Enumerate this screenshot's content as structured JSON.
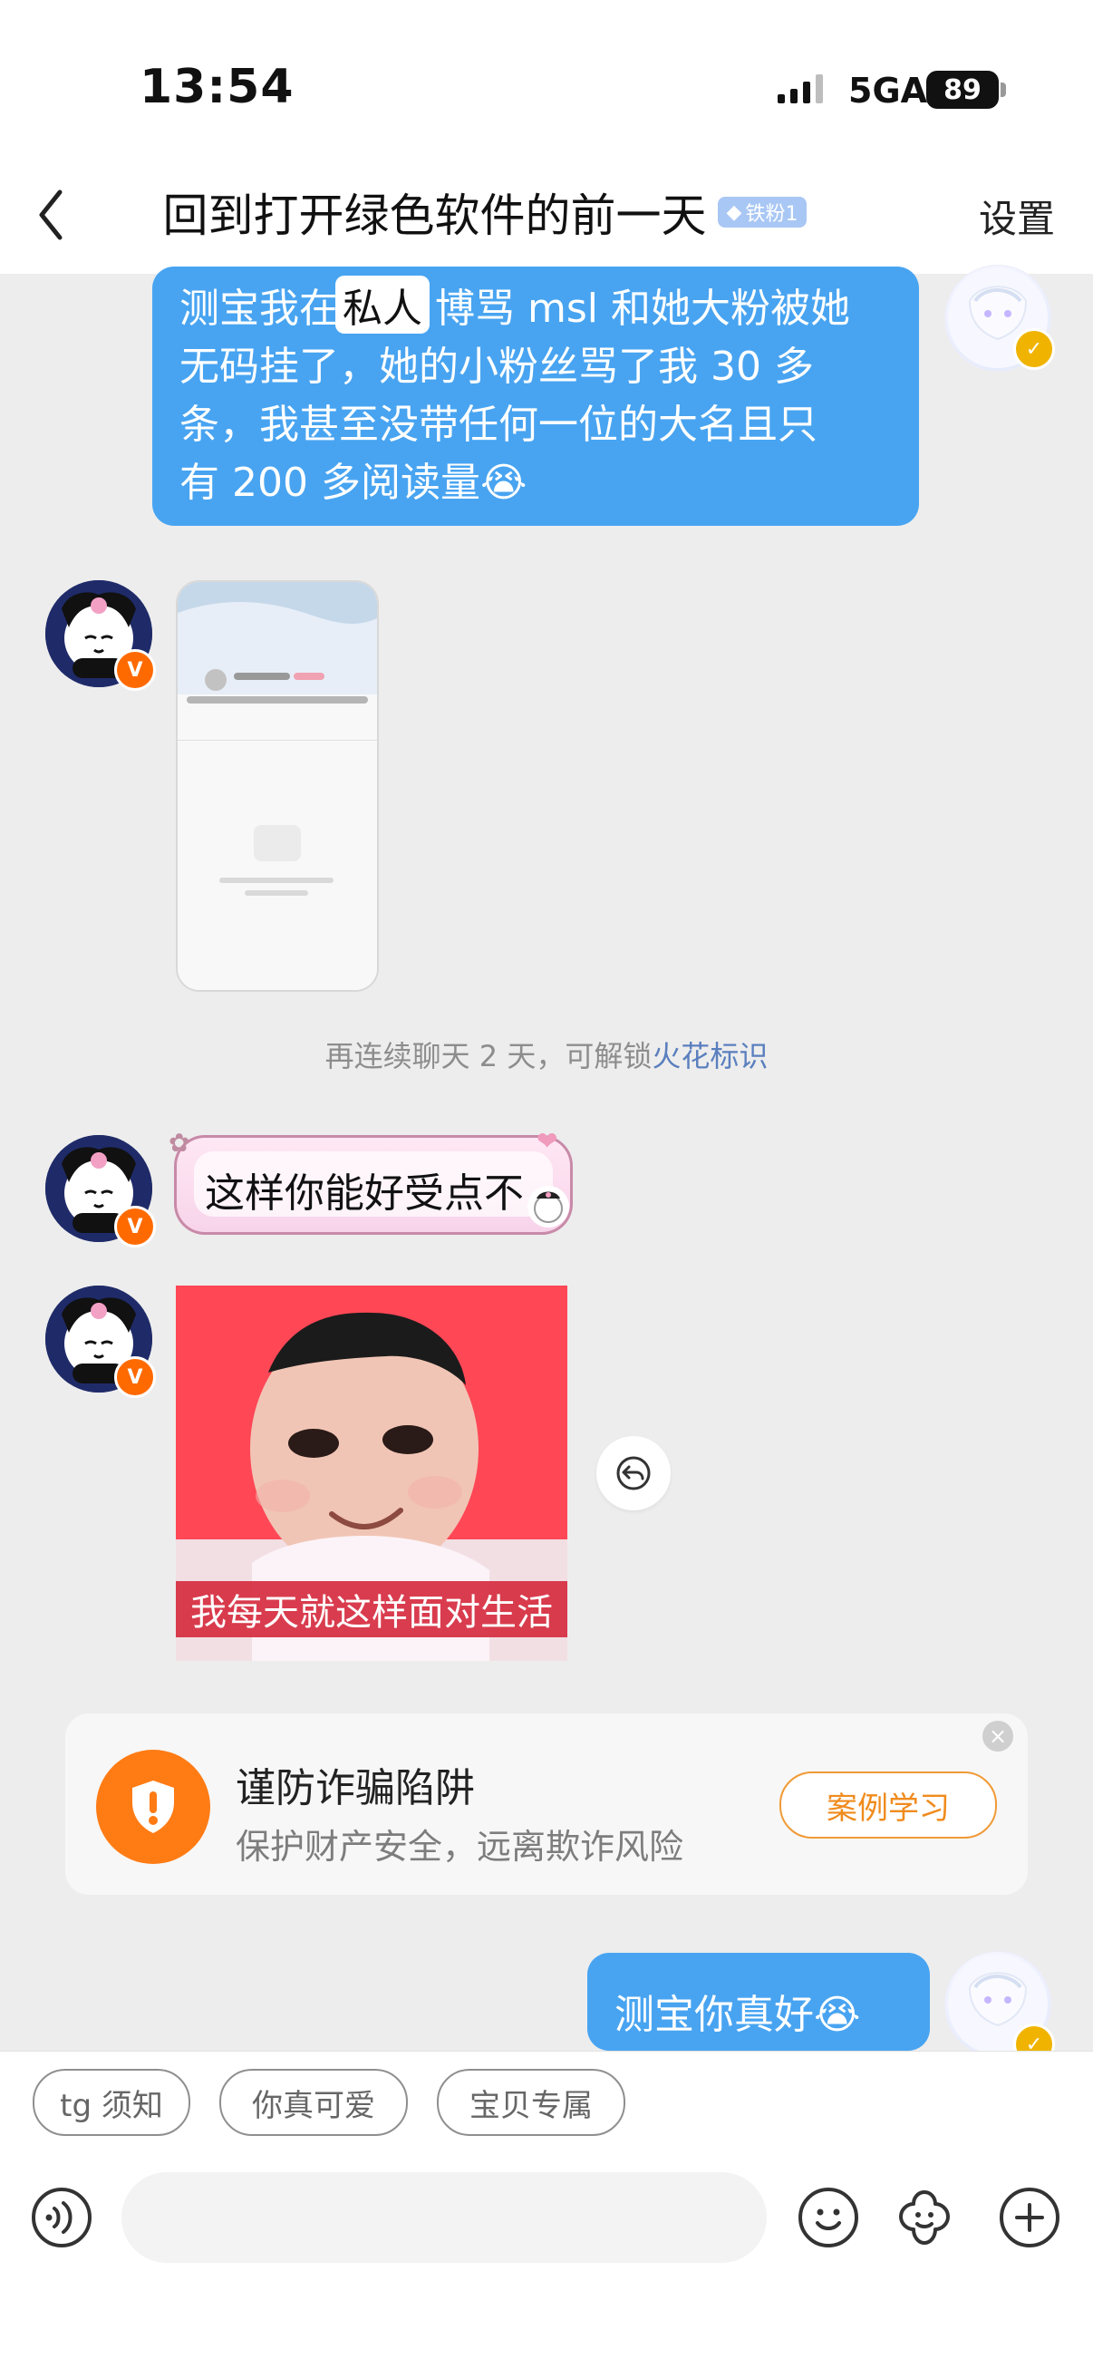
{
  "status": {
    "time": "13:54",
    "network": "5GA",
    "battery": "89"
  },
  "header": {
    "title": "回到打开绿色软件的前一天",
    "badge": "铁粉1",
    "settings": "设置"
  },
  "messages": {
    "top_text": "测宝我在私人博骂 msl 和她大粉被她无码挂了，她的小粉丝骂了我 30 多条，我甚至没带任何一位的大名且只有 200 多阅读量😭",
    "top_text_lines": [
      "测宝我在",
      "私人",
      "博骂 msl 和她大粉被她",
      "无码挂了，她的小粉丝骂了我 30 多",
      "条，我甚至没带任何一位的大名且只",
      "有 200 多阅读量😭"
    ],
    "system_tip_prefix": "再连续聊天 2 天，可解锁",
    "system_tip_link": "火花标识",
    "sticker_text": "这样你能好受点不",
    "meme_caption": "我每天就这样面对生活",
    "last_message": "测宝你真好😭"
  },
  "notice": {
    "title": "谨防诈骗陷阱",
    "subtitle": "保护财产安全，远离欺诈风险",
    "button": "案例学习"
  },
  "quick_replies": [
    "tg 须知",
    "你真可爱",
    "宝贝专属"
  ],
  "input": {
    "placeholder": ""
  },
  "icons": {
    "back": "back-icon",
    "voice": "voice-icon",
    "emoji": "emoji-icon",
    "sticker": "sticker-icon",
    "add": "add-icon",
    "retract": "retract-icon",
    "warning": "warning-shield-icon",
    "close": "close-icon"
  },
  "colors": {
    "accent_blue": "#48a4f1",
    "warning_orange": "#ff7b14",
    "link_blue": "#5a7fbe",
    "background": "#ededed"
  }
}
